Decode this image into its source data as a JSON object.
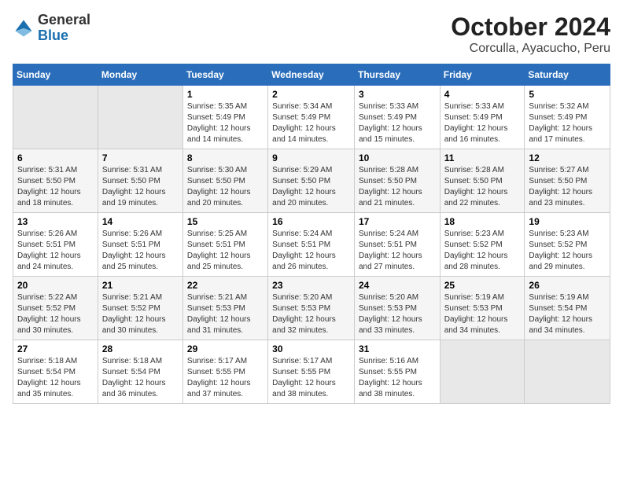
{
  "logo": {
    "general": "General",
    "blue": "Blue"
  },
  "title": "October 2024",
  "subtitle": "Corculla, Ayacucho, Peru",
  "days_header": [
    "Sunday",
    "Monday",
    "Tuesday",
    "Wednesday",
    "Thursday",
    "Friday",
    "Saturday"
  ],
  "weeks": [
    [
      {
        "day": "",
        "empty": true
      },
      {
        "day": "",
        "empty": true
      },
      {
        "day": "1",
        "sunrise": "Sunrise: 5:35 AM",
        "sunset": "Sunset: 5:49 PM",
        "daylight": "Daylight: 12 hours and 14 minutes."
      },
      {
        "day": "2",
        "sunrise": "Sunrise: 5:34 AM",
        "sunset": "Sunset: 5:49 PM",
        "daylight": "Daylight: 12 hours and 14 minutes."
      },
      {
        "day": "3",
        "sunrise": "Sunrise: 5:33 AM",
        "sunset": "Sunset: 5:49 PM",
        "daylight": "Daylight: 12 hours and 15 minutes."
      },
      {
        "day": "4",
        "sunrise": "Sunrise: 5:33 AM",
        "sunset": "Sunset: 5:49 PM",
        "daylight": "Daylight: 12 hours and 16 minutes."
      },
      {
        "day": "5",
        "sunrise": "Sunrise: 5:32 AM",
        "sunset": "Sunset: 5:49 PM",
        "daylight": "Daylight: 12 hours and 17 minutes."
      }
    ],
    [
      {
        "day": "6",
        "sunrise": "Sunrise: 5:31 AM",
        "sunset": "Sunset: 5:50 PM",
        "daylight": "Daylight: 12 hours and 18 minutes."
      },
      {
        "day": "7",
        "sunrise": "Sunrise: 5:31 AM",
        "sunset": "Sunset: 5:50 PM",
        "daylight": "Daylight: 12 hours and 19 minutes."
      },
      {
        "day": "8",
        "sunrise": "Sunrise: 5:30 AM",
        "sunset": "Sunset: 5:50 PM",
        "daylight": "Daylight: 12 hours and 20 minutes."
      },
      {
        "day": "9",
        "sunrise": "Sunrise: 5:29 AM",
        "sunset": "Sunset: 5:50 PM",
        "daylight": "Daylight: 12 hours and 20 minutes."
      },
      {
        "day": "10",
        "sunrise": "Sunrise: 5:28 AM",
        "sunset": "Sunset: 5:50 PM",
        "daylight": "Daylight: 12 hours and 21 minutes."
      },
      {
        "day": "11",
        "sunrise": "Sunrise: 5:28 AM",
        "sunset": "Sunset: 5:50 PM",
        "daylight": "Daylight: 12 hours and 22 minutes."
      },
      {
        "day": "12",
        "sunrise": "Sunrise: 5:27 AM",
        "sunset": "Sunset: 5:50 PM",
        "daylight": "Daylight: 12 hours and 23 minutes."
      }
    ],
    [
      {
        "day": "13",
        "sunrise": "Sunrise: 5:26 AM",
        "sunset": "Sunset: 5:51 PM",
        "daylight": "Daylight: 12 hours and 24 minutes."
      },
      {
        "day": "14",
        "sunrise": "Sunrise: 5:26 AM",
        "sunset": "Sunset: 5:51 PM",
        "daylight": "Daylight: 12 hours and 25 minutes."
      },
      {
        "day": "15",
        "sunrise": "Sunrise: 5:25 AM",
        "sunset": "Sunset: 5:51 PM",
        "daylight": "Daylight: 12 hours and 25 minutes."
      },
      {
        "day": "16",
        "sunrise": "Sunrise: 5:24 AM",
        "sunset": "Sunset: 5:51 PM",
        "daylight": "Daylight: 12 hours and 26 minutes."
      },
      {
        "day": "17",
        "sunrise": "Sunrise: 5:24 AM",
        "sunset": "Sunset: 5:51 PM",
        "daylight": "Daylight: 12 hours and 27 minutes."
      },
      {
        "day": "18",
        "sunrise": "Sunrise: 5:23 AM",
        "sunset": "Sunset: 5:52 PM",
        "daylight": "Daylight: 12 hours and 28 minutes."
      },
      {
        "day": "19",
        "sunrise": "Sunrise: 5:23 AM",
        "sunset": "Sunset: 5:52 PM",
        "daylight": "Daylight: 12 hours and 29 minutes."
      }
    ],
    [
      {
        "day": "20",
        "sunrise": "Sunrise: 5:22 AM",
        "sunset": "Sunset: 5:52 PM",
        "daylight": "Daylight: 12 hours and 30 minutes."
      },
      {
        "day": "21",
        "sunrise": "Sunrise: 5:21 AM",
        "sunset": "Sunset: 5:52 PM",
        "daylight": "Daylight: 12 hours and 30 minutes."
      },
      {
        "day": "22",
        "sunrise": "Sunrise: 5:21 AM",
        "sunset": "Sunset: 5:53 PM",
        "daylight": "Daylight: 12 hours and 31 minutes."
      },
      {
        "day": "23",
        "sunrise": "Sunrise: 5:20 AM",
        "sunset": "Sunset: 5:53 PM",
        "daylight": "Daylight: 12 hours and 32 minutes."
      },
      {
        "day": "24",
        "sunrise": "Sunrise: 5:20 AM",
        "sunset": "Sunset: 5:53 PM",
        "daylight": "Daylight: 12 hours and 33 minutes."
      },
      {
        "day": "25",
        "sunrise": "Sunrise: 5:19 AM",
        "sunset": "Sunset: 5:53 PM",
        "daylight": "Daylight: 12 hours and 34 minutes."
      },
      {
        "day": "26",
        "sunrise": "Sunrise: 5:19 AM",
        "sunset": "Sunset: 5:54 PM",
        "daylight": "Daylight: 12 hours and 34 minutes."
      }
    ],
    [
      {
        "day": "27",
        "sunrise": "Sunrise: 5:18 AM",
        "sunset": "Sunset: 5:54 PM",
        "daylight": "Daylight: 12 hours and 35 minutes."
      },
      {
        "day": "28",
        "sunrise": "Sunrise: 5:18 AM",
        "sunset": "Sunset: 5:54 PM",
        "daylight": "Daylight: 12 hours and 36 minutes."
      },
      {
        "day": "29",
        "sunrise": "Sunrise: 5:17 AM",
        "sunset": "Sunset: 5:55 PM",
        "daylight": "Daylight: 12 hours and 37 minutes."
      },
      {
        "day": "30",
        "sunrise": "Sunrise: 5:17 AM",
        "sunset": "Sunset: 5:55 PM",
        "daylight": "Daylight: 12 hours and 38 minutes."
      },
      {
        "day": "31",
        "sunrise": "Sunrise: 5:16 AM",
        "sunset": "Sunset: 5:55 PM",
        "daylight": "Daylight: 12 hours and 38 minutes."
      },
      {
        "day": "",
        "empty": true
      },
      {
        "day": "",
        "empty": true
      }
    ]
  ]
}
